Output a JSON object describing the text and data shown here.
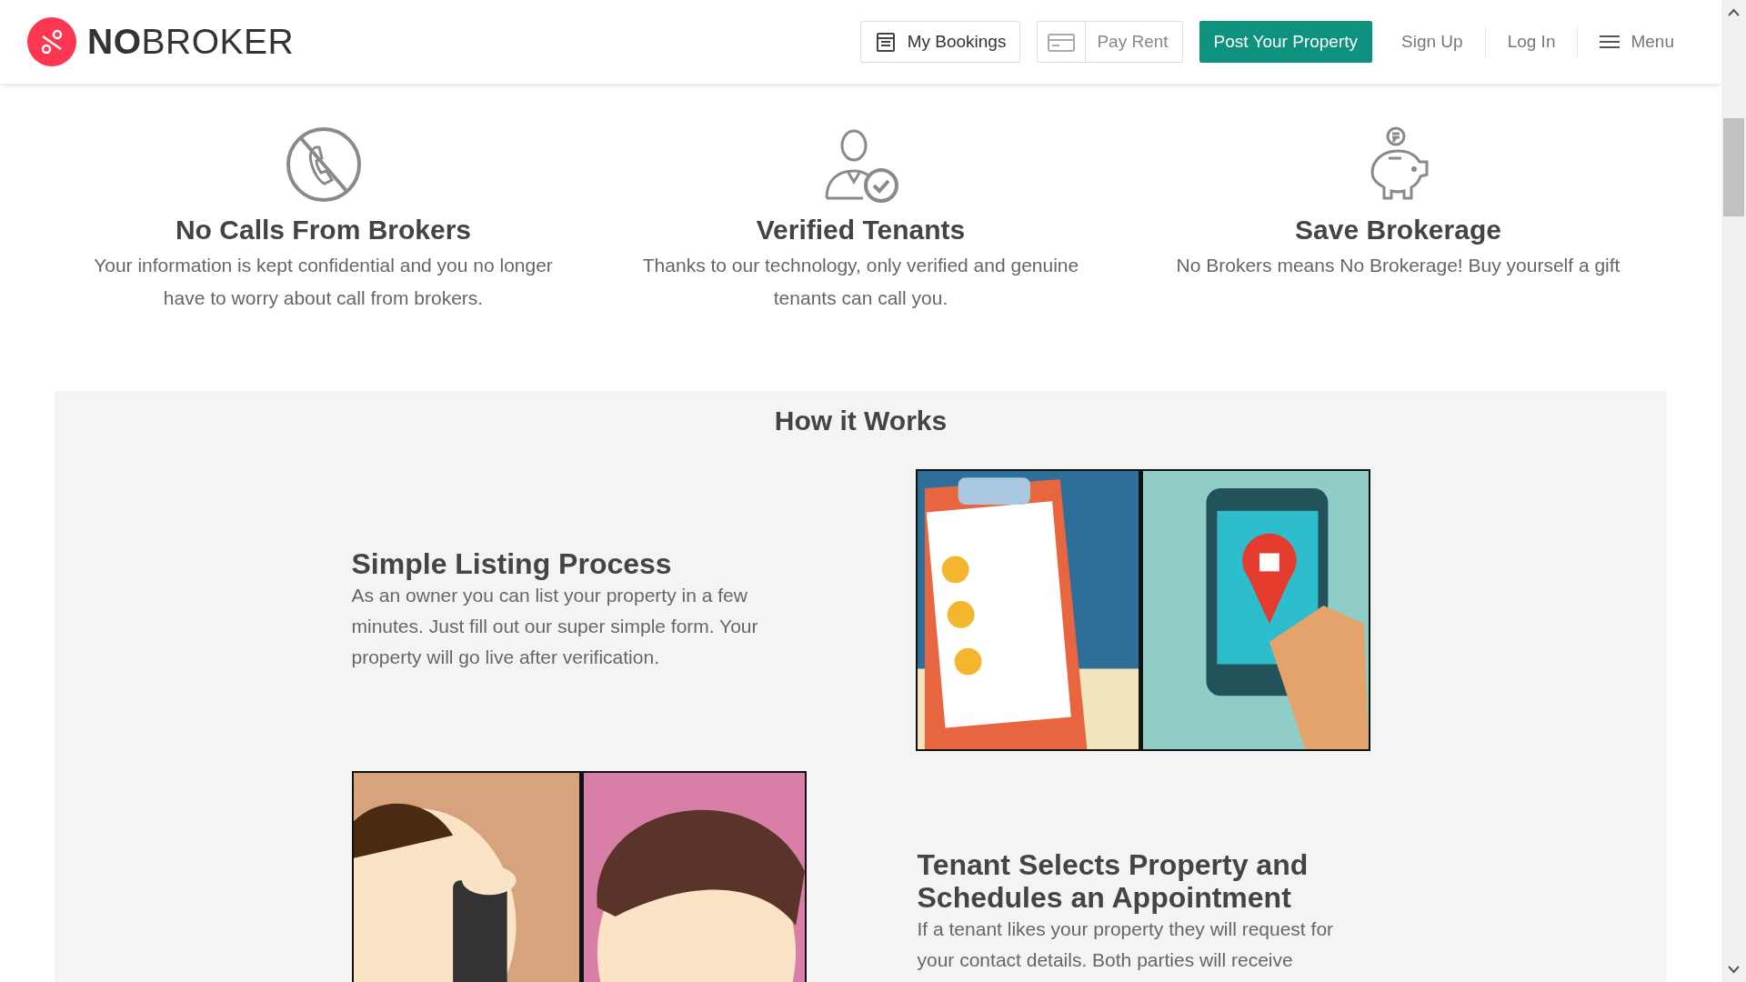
{
  "header": {
    "logo": "**NO**BROKER",
    "nav": [
      {
        "kind": "outline",
        "label": "My Bookings"
      },
      {
        "kind": "outline-split",
        "label": "Pay Rent"
      },
      {
        "kind": "primary",
        "label": "Post Your Property"
      },
      {
        "kind": "link",
        "label": "Sign Up"
      },
      {
        "kind": "link",
        "label": "Log In"
      },
      {
        "kind": "menu",
        "label": "Menu"
      }
    ]
  },
  "features": [
    {
      "title": "No Calls From Brokers",
      "text": "Your information is kept confidential and you no longer have to worry about call from brokers."
    },
    {
      "title": "Verified Tenants",
      "text": "Thanks to our technology, only verified and genuine tenants can call you."
    },
    {
      "title": "Save Brokerage",
      "text": "No Brokers means No Brokerage! Buy yourself a gift"
    }
  ],
  "how_it_works": {
    "title": "How it Works",
    "steps": [
      {
        "title": "Simple Listing Process",
        "text": "As an owner you can list your property in a few minutes. Just fill out our super simple form. Your property will go live after verification.",
        "kind": "image-right"
      },
      {
        "title": "Tenant Selects Property and Schedules an Appointment",
        "text": "If a tenant likes your property they will request for your contact details. Both parties will receive",
        "kind": "image-left"
      }
    ]
  }
}
